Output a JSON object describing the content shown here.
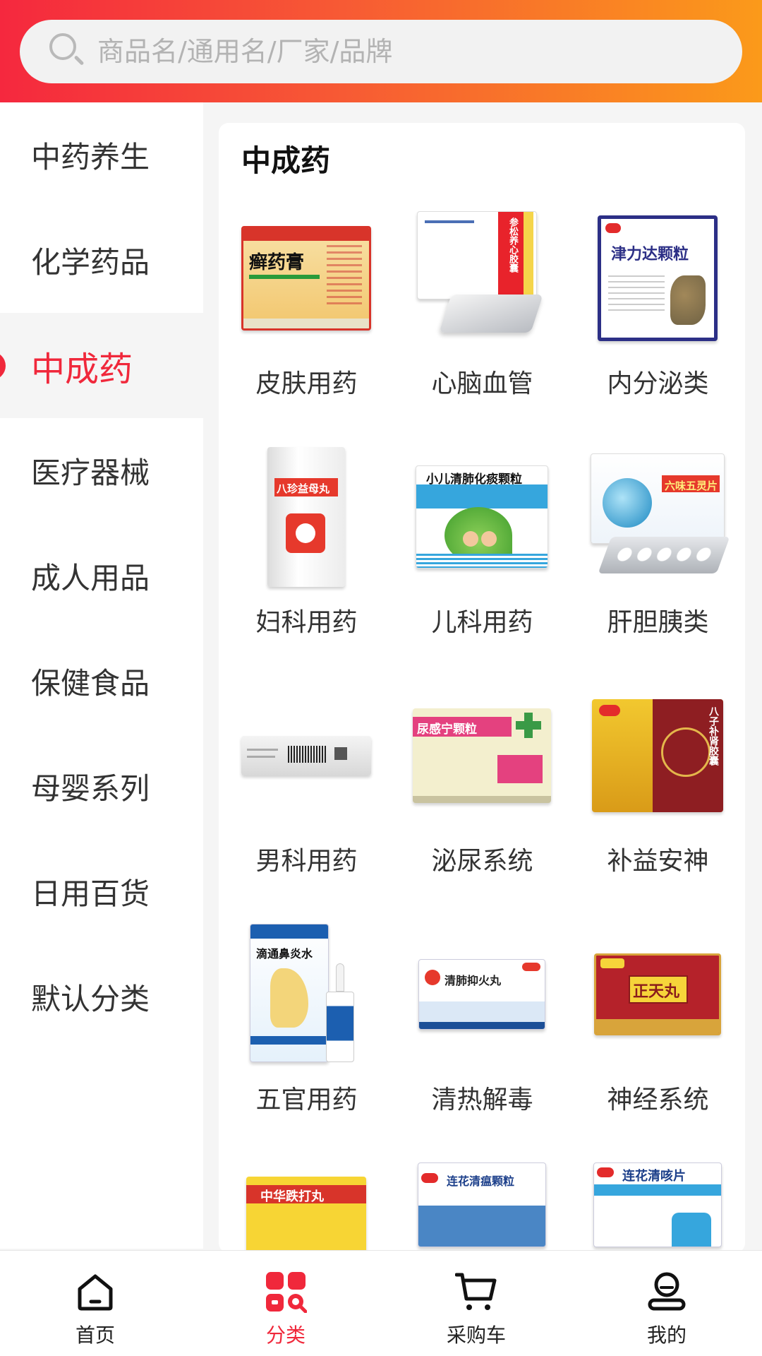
{
  "search": {
    "placeholder": "商品名/通用名/厂家/品牌"
  },
  "sidebar": {
    "items": [
      {
        "label": "中药养生"
      },
      {
        "label": "化学药品"
      },
      {
        "label": "中成药"
      },
      {
        "label": "医疗器械"
      },
      {
        "label": "成人用品"
      },
      {
        "label": "保健食品"
      },
      {
        "label": "母婴系列"
      },
      {
        "label": "日用百货"
      },
      {
        "label": "默认分类"
      }
    ],
    "active_index": 2
  },
  "content": {
    "title": "中成药",
    "categories": [
      {
        "label": "皮肤用药",
        "product_text": "癣药膏"
      },
      {
        "label": "心脑血管",
        "product_text": "参松养心胶囊"
      },
      {
        "label": "内分泌类",
        "product_text": "津力达颗粒"
      },
      {
        "label": "妇科用药",
        "product_text": "八珍益母丸"
      },
      {
        "label": "儿科用药",
        "product_text": "小儿清肺化痰颗粒"
      },
      {
        "label": "肝胆胰类",
        "product_text": "六味五灵片"
      },
      {
        "label": "男科用药",
        "product_text": ""
      },
      {
        "label": "泌尿系统",
        "product_text": "尿感宁颗粒"
      },
      {
        "label": "补益安神",
        "product_text": "八子补肾胶囊"
      },
      {
        "label": "五官用药",
        "product_text": "滴通鼻炎水"
      },
      {
        "label": "清热解毒",
        "product_text": "清肺抑火丸"
      },
      {
        "label": "神经系统",
        "product_text": "正天丸"
      },
      {
        "label": "",
        "product_text": "中华跌打丸"
      },
      {
        "label": "",
        "product_text": "连花清瘟颗粒"
      },
      {
        "label": "",
        "product_text": "连花清咳片"
      }
    ]
  },
  "tabbar": {
    "items": [
      {
        "label": "首页",
        "icon": "home-icon"
      },
      {
        "label": "分类",
        "icon": "category-icon"
      },
      {
        "label": "采购车",
        "icon": "cart-icon"
      },
      {
        "label": "我的",
        "icon": "profile-icon"
      }
    ],
    "active_index": 1
  },
  "colors": {
    "accent": "#f0283b",
    "gradient_start": "#f5283e",
    "gradient_end": "#fb9a1a"
  }
}
